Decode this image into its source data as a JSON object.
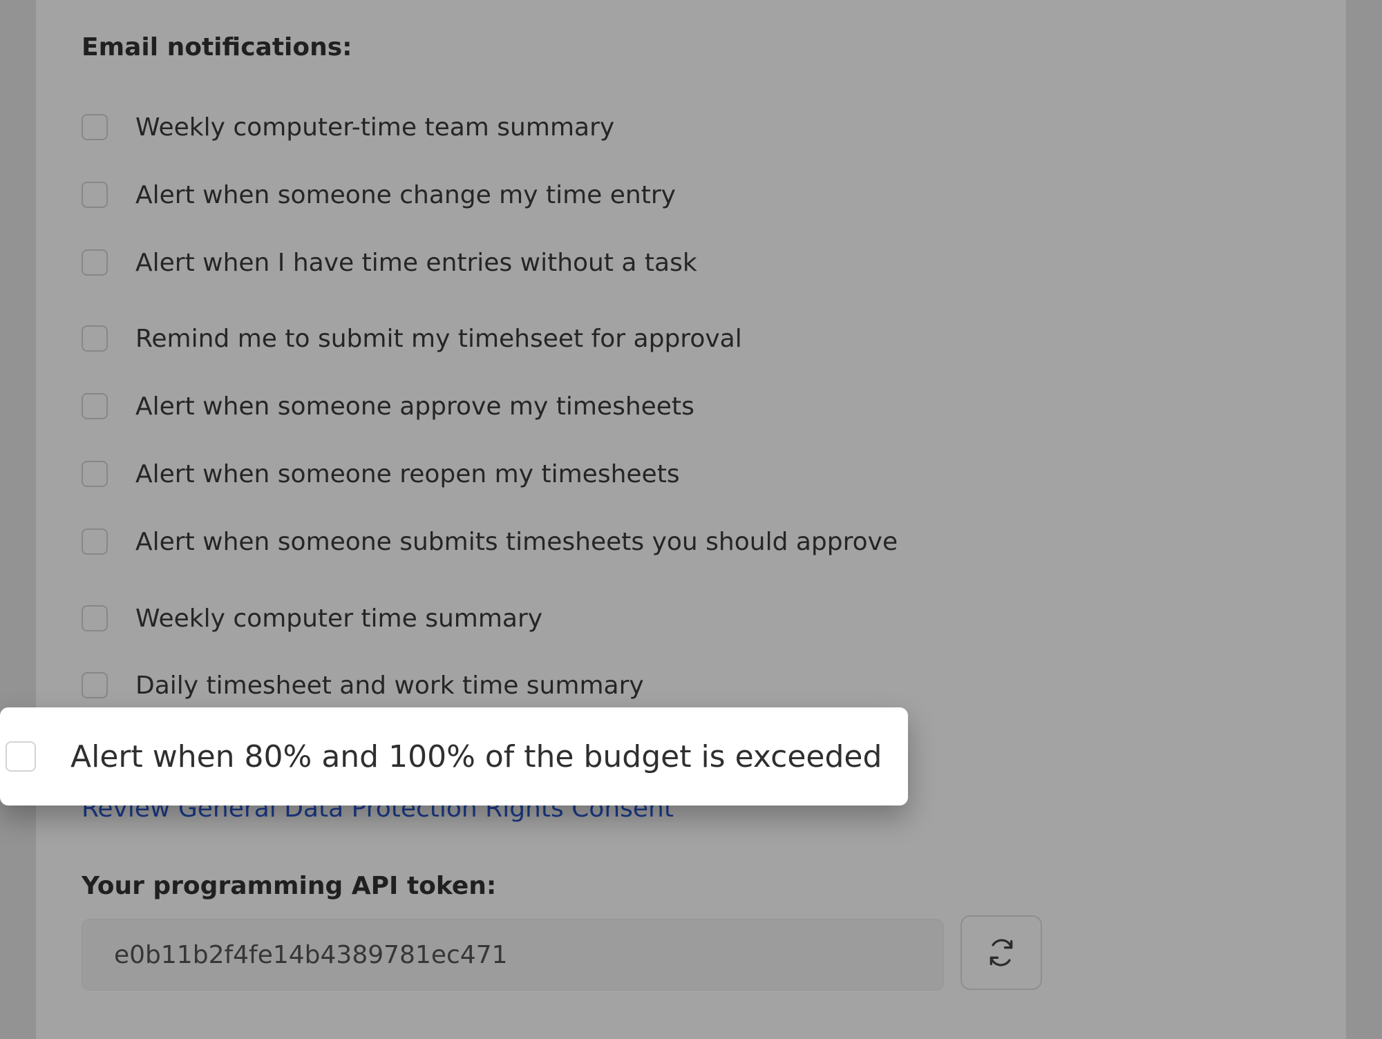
{
  "email_notifications": {
    "title": "Email notifications:",
    "options": [
      {
        "label": "Weekly computer-time team summary",
        "checked": false
      },
      {
        "label": "Alert when someone change my time entry",
        "checked": false
      },
      {
        "label": "Alert when I have time entries without a task",
        "checked": false
      },
      {
        "label": "Remind me to submit my timehseet for approval",
        "checked": false
      },
      {
        "label": "Alert when someone approve my timesheets",
        "checked": false
      },
      {
        "label": "Alert when someone reopen my timesheets",
        "checked": false
      },
      {
        "label": "Alert when someone submits timesheets you should approve",
        "checked": false
      },
      {
        "label": "Weekly computer time summary",
        "checked": false
      },
      {
        "label": "Daily timesheet and work time summary",
        "checked": false
      }
    ],
    "highlighted_option": {
      "label": "Alert when 80% and 100% of the budget is exceeded",
      "checked": false
    }
  },
  "gdpr_link": "Review General Data Protection Rights Consent",
  "api": {
    "title": "Your programming API token:",
    "token": "e0b11b2f4fe14b4389781ec471",
    "refresh_icon": "refresh-icon"
  },
  "colors": {
    "link": "#2b5bd8",
    "overlay": "rgba(0,0,0,0.36)"
  }
}
